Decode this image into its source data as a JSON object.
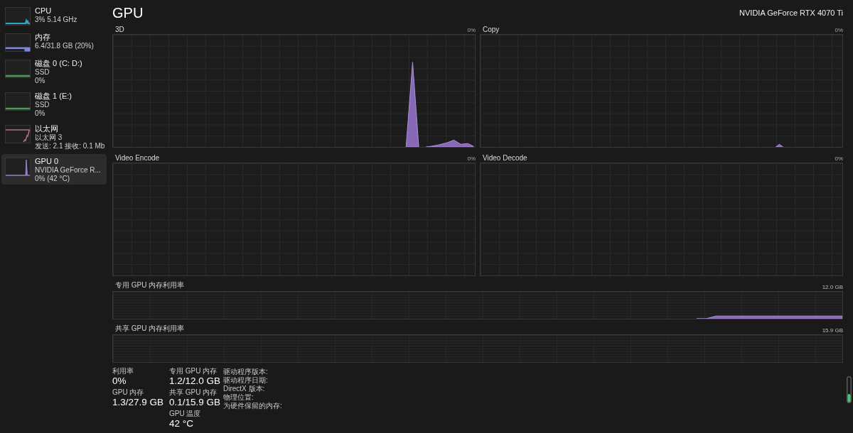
{
  "sidebar": {
    "items": [
      {
        "name": "CPU",
        "lines": [
          "3% 5.14 GHz"
        ],
        "color": "#2ea8c8",
        "selected": false
      },
      {
        "name": "内存",
        "lines": [
          "6.4/31.8 GB (20%)"
        ],
        "color": "#7d86d9",
        "selected": false
      },
      {
        "name": "磁盘 0 (C: D:)",
        "lines": [
          "SSD",
          "0%"
        ],
        "color": "#4e9a5b",
        "selected": false
      },
      {
        "name": "磁盘 1 (E:)",
        "lines": [
          "SSD",
          "0%"
        ],
        "color": "#4e9a5b",
        "selected": false
      },
      {
        "name": "以太网",
        "lines": [
          "以太网 3",
          "发送: 2.1 接收: 0.1 Mb"
        ],
        "color": "#b0707a",
        "selected": false
      },
      {
        "name": "GPU 0",
        "lines": [
          "NVIDIA GeForce R...",
          "0% (42 °C)"
        ],
        "color": "#9b7fc6",
        "selected": true
      }
    ]
  },
  "header": {
    "title": "GPU",
    "device": "NVIDIA GeForce RTX 4070 Ti"
  },
  "engine_graphs": [
    {
      "label": "3D",
      "reading": "0%"
    },
    {
      "label": "Copy",
      "reading": "0%"
    },
    {
      "label": "Video Encode",
      "reading": "0%"
    },
    {
      "label": "Video Decode",
      "reading": "0%"
    }
  ],
  "memory_graphs": [
    {
      "label": "专用 GPU 内存利用率",
      "capacity": "12.0 GB"
    },
    {
      "label": "共享 GPU 内存利用率",
      "capacity": "15.9 GB"
    }
  ],
  "stats": {
    "columns": [
      [
        {
          "label": "利用率",
          "value": "0%"
        },
        {
          "label": "GPU 内存",
          "value": "1.3/27.9 GB"
        }
      ],
      [
        {
          "label": "专用 GPU 内存",
          "value": "1.2/12.0 GB"
        },
        {
          "label": "共享 GPU 内存",
          "value": "0.1/15.9 GB"
        },
        {
          "label": "GPU 温度",
          "value": "42 °C"
        }
      ]
    ],
    "details": [
      "驱动程序版本:",
      "驱动程序日期:",
      "DirectX 版本:",
      "物理位置:",
      "为硬件保留的内存:"
    ]
  }
}
